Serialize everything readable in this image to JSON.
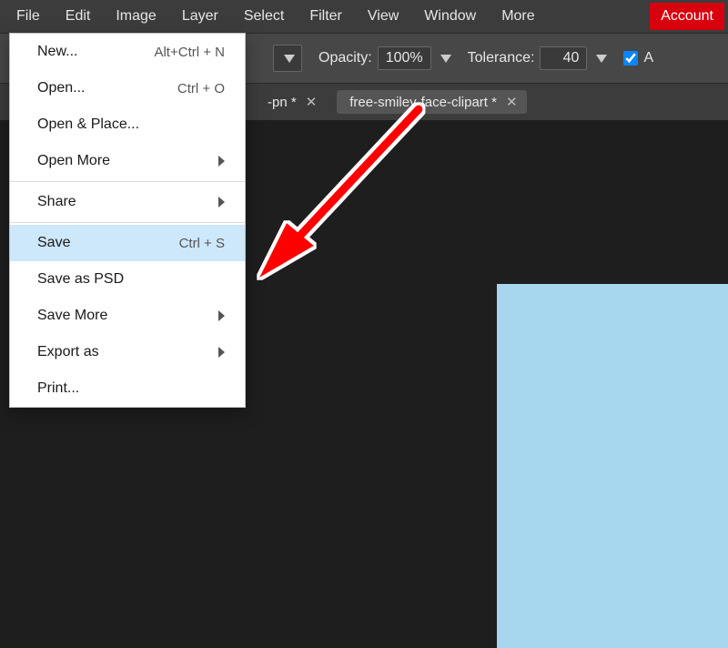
{
  "menubar": {
    "items": [
      "File",
      "Edit",
      "Image",
      "Layer",
      "Select",
      "Filter",
      "View",
      "Window",
      "More"
    ],
    "account": "Account"
  },
  "optionsbar": {
    "opacity_label": "Opacity:",
    "opacity_value": "100%",
    "tolerance_label": "Tolerance:",
    "tolerance_value": "40",
    "anti_alias_label": "A",
    "anti_alias_checked": true
  },
  "tabstrip": {
    "tabs": [
      {
        "label": "-pn *",
        "active": false
      },
      {
        "label": "free-smiley-face-clipart *",
        "active": true
      }
    ]
  },
  "dropdown": {
    "items": [
      {
        "kind": "item",
        "label": "New...",
        "accel": "Alt+Ctrl + N"
      },
      {
        "kind": "item",
        "label": "Open...",
        "accel": "Ctrl + O"
      },
      {
        "kind": "item",
        "label": "Open & Place..."
      },
      {
        "kind": "submenu",
        "label": "Open More"
      },
      {
        "kind": "sep"
      },
      {
        "kind": "submenu",
        "label": "Share"
      },
      {
        "kind": "sep"
      },
      {
        "kind": "item",
        "label": "Save",
        "accel": "Ctrl + S",
        "highlight": true
      },
      {
        "kind": "item",
        "label": "Save as PSD"
      },
      {
        "kind": "submenu",
        "label": "Save More"
      },
      {
        "kind": "submenu",
        "label": "Export as"
      },
      {
        "kind": "item",
        "label": "Print..."
      }
    ]
  },
  "artboard": {
    "fill": "#a7d7ee"
  },
  "annotation": {
    "arrow_color": "#ff0000"
  }
}
